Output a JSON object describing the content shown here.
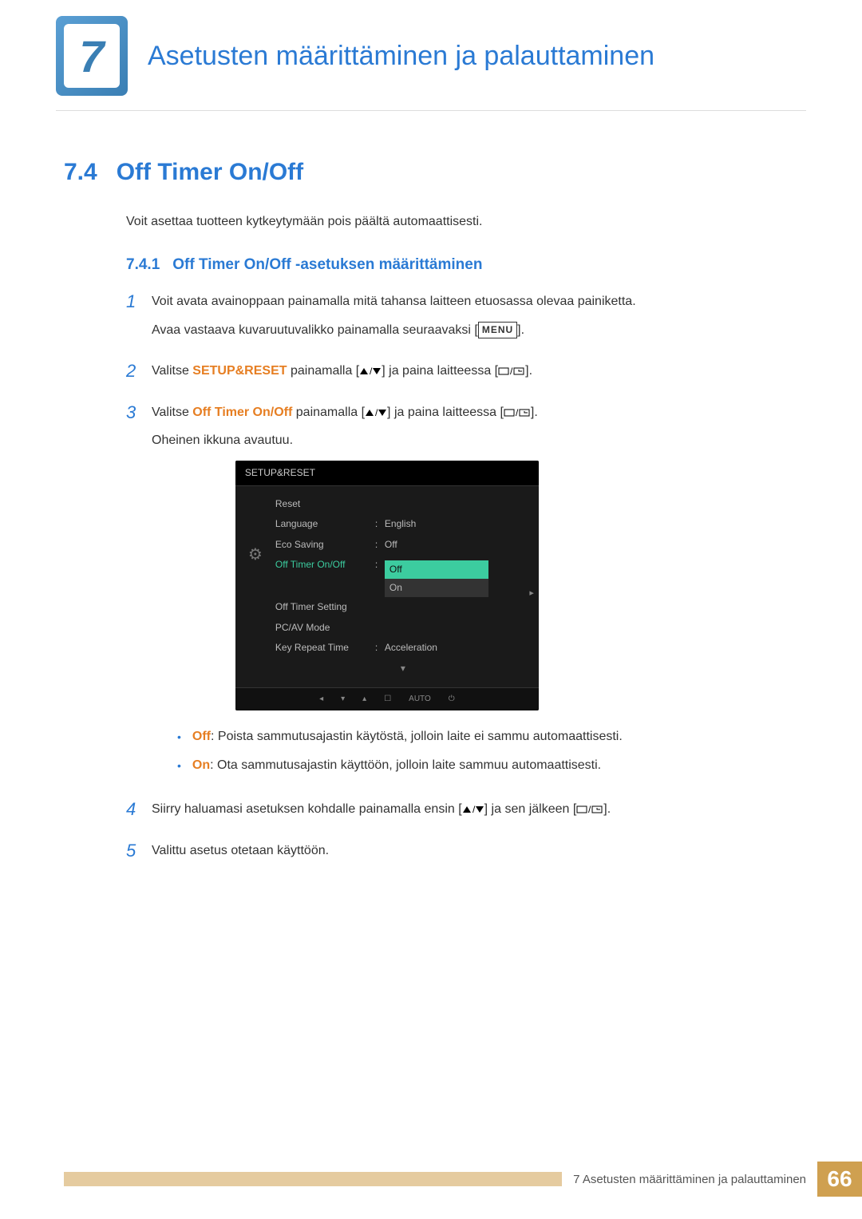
{
  "chapter": {
    "number": "7",
    "title": "Asetusten määrittäminen ja palauttaminen"
  },
  "section": {
    "number": "7.4",
    "title": "Off Timer On/Off",
    "intro": "Voit asettaa tuotteen kytkeytymään pois päältä automaattisesti."
  },
  "subsection": {
    "number": "7.4.1",
    "title": "Off Timer On/Off -asetuksen määrittäminen"
  },
  "steps": {
    "s1a": "Voit avata avainoppaan painamalla mitä tahansa laitteen etuosassa olevaa painiketta.",
    "s1b_pre": "Avaa vastaava kuvaruutuvalikko painamalla seuraavaksi [",
    "s1b_btn": "MENU",
    "s1b_post": "].",
    "s2_pre": "Valitse ",
    "s2_strong": "SETUP&RESET",
    "s2_mid1": " painamalla [",
    "s2_mid2": "] ja paina laitteessa [",
    "s2_post": "].",
    "s3_pre": "Valitse ",
    "s3_strong": "Off Timer On/Off",
    "s3_mid1": " painamalla [",
    "s3_mid2": "] ja paina laitteessa [",
    "s3_post": "].",
    "s3_after": "Oheinen ikkuna avautuu.",
    "s4_pre": "Siirry haluamasi asetuksen kohdalle painamalla ensin [",
    "s4_mid": "] ja sen jälkeen [",
    "s4_post": "].",
    "s5": "Valittu asetus otetaan käyttöön."
  },
  "osd": {
    "title": "SETUP&RESET",
    "rows": [
      {
        "label": "Reset",
        "value": ""
      },
      {
        "label": "Language",
        "value": "English"
      },
      {
        "label": "Eco Saving",
        "value": "Off"
      },
      {
        "label": "Off Timer On/Off",
        "value": ""
      },
      {
        "label": "Off Timer Setting",
        "value": ""
      },
      {
        "label": "PC/AV Mode",
        "value": ""
      },
      {
        "label": "Key Repeat Time",
        "value": "Acceleration"
      }
    ],
    "sel": "Off",
    "opt": "On",
    "footer_auto": "AUTO"
  },
  "bullets": {
    "off_key": "Off",
    "off_text": ": Poista sammutusajastin käytöstä, jolloin laite ei sammu automaattisesti.",
    "on_key": "On",
    "on_text": ": Ota sammutusajastin käyttöön, jolloin laite sammuu automaattisesti."
  },
  "footer": {
    "text": "7 Asetusten määrittäminen ja palauttaminen",
    "page": "66"
  }
}
